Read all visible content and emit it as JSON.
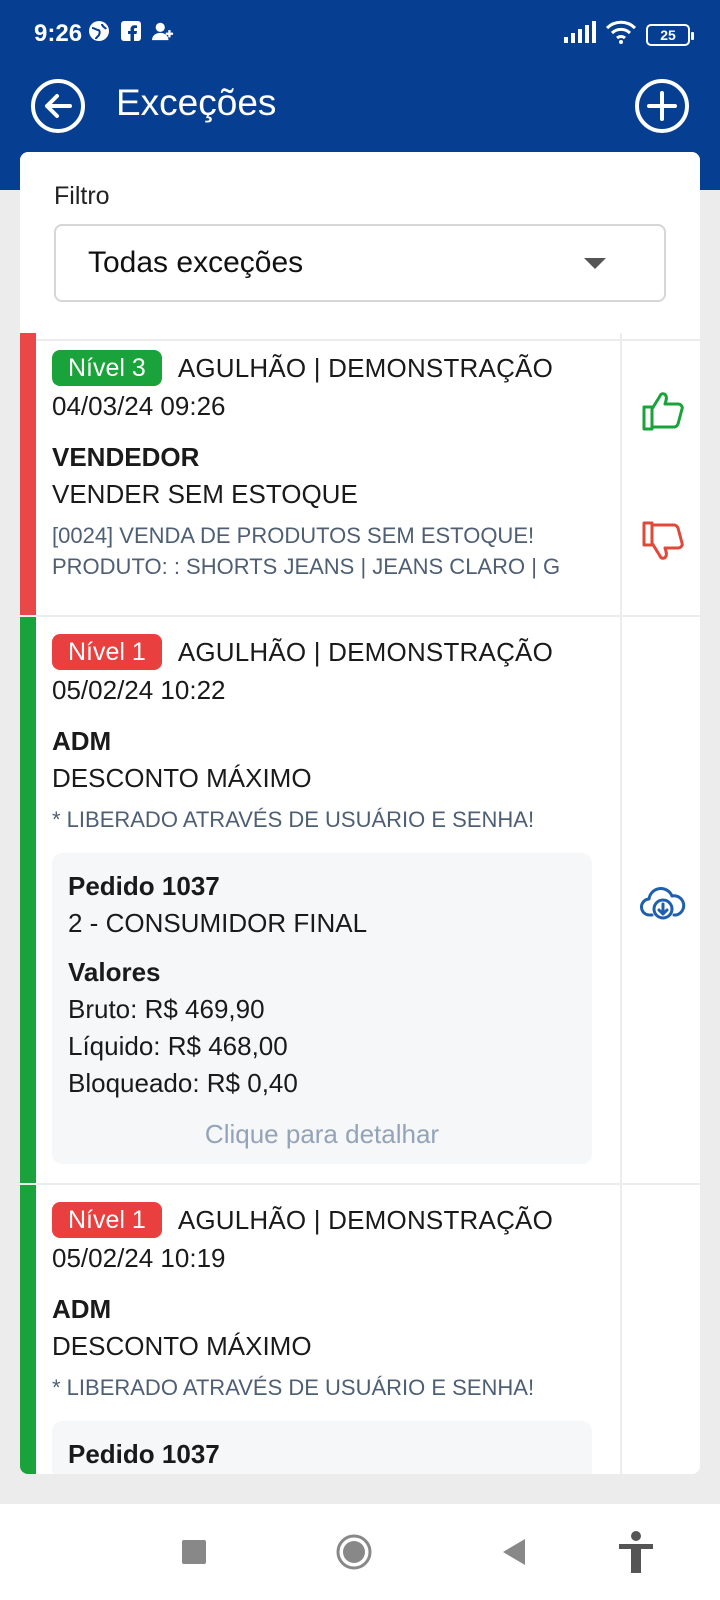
{
  "status_bar": {
    "time": "9:26",
    "battery": "25",
    "icons": [
      "globe-icon",
      "facebook-icon",
      "add-contact-icon",
      "signal-icon",
      "wifi-icon",
      "battery-icon"
    ]
  },
  "app_bar": {
    "title": "Exceções",
    "back_icon": "arrow-left-circle-icon",
    "add_icon": "plus-circle-icon"
  },
  "filter": {
    "label": "Filtro",
    "selected": "Todas exceções"
  },
  "colors": {
    "header": "#063f92",
    "badge_green": "#19a33a",
    "badge_red": "#ea3f3f",
    "approve": "#19a33a",
    "reject": "#e0493a",
    "download": "#1f5fae"
  },
  "items": [
    {
      "badge": "Nível 3",
      "badge_color": "green",
      "bar_color": "#ea4848",
      "company": "AGULHÃO | DEMONSTRAÇÃO",
      "date": "04/03/24 09:26",
      "role": "VENDEDOR",
      "exception": "VENDER SEM ESTOQUE",
      "description_line1": "[0024] VENDA DE PRODUTOS SEM ESTOQUE!",
      "description_line2": "PRODUTO: : SHORTS JEANS | JEANS CLARO | G",
      "actions": [
        "thumbs-up-icon",
        "thumbs-down-icon"
      ]
    },
    {
      "badge": "Nível 1",
      "badge_color": "red",
      "bar_color": "#1aa33a",
      "company": "AGULHÃO | DEMONSTRAÇÃO",
      "date": "05/02/24 10:22",
      "role": "ADM",
      "exception": "DESCONTO MÁXIMO",
      "description": "* LIBERADO ATRAVÉS DE USUÁRIO E SENHA!",
      "order": {
        "title": "Pedido 1037",
        "customer": "2 - CONSUMIDOR FINAL",
        "values_title": "Valores",
        "gross": "Bruto: R$ 469,90",
        "net": "Líquido: R$ 468,00",
        "blocked": "Bloqueado: R$ 0,40",
        "detail_link": "Clique para detalhar"
      },
      "actions": [
        "cloud-download-icon"
      ]
    },
    {
      "badge": "Nível 1",
      "badge_color": "red",
      "bar_color": "#1aa33a",
      "company": "AGULHÃO | DEMONSTRAÇÃO",
      "date": "05/02/24 10:19",
      "role": "ADM",
      "exception": "DESCONTO MÁXIMO",
      "description": "* LIBERADO ATRAVÉS DE USUÁRIO E SENHA!",
      "order": {
        "title": "Pedido 1037"
      }
    }
  ],
  "nav_bar": [
    "recent-apps-icon",
    "home-icon",
    "back-icon",
    "accessibility-icon"
  ]
}
